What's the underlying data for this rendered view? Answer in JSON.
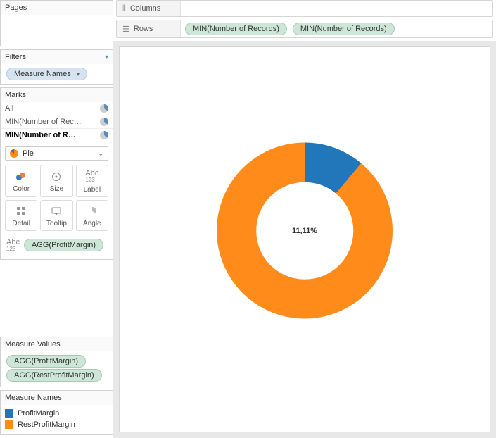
{
  "sidebar": {
    "pages": {
      "title": "Pages"
    },
    "filters": {
      "title": "Filters",
      "pill": "Measure Names"
    },
    "marks": {
      "title": "Marks",
      "rows": [
        "All",
        "MIN(Number of Rec…",
        "MIN(Number of R…"
      ],
      "mark_type": "Pie",
      "buttons": {
        "color": "Color",
        "size": "Size",
        "label": "Label",
        "detail": "Detail",
        "tooltip": "Tooltip",
        "angle": "Angle"
      },
      "drop_pill": "AGG(ProfitMargin)"
    },
    "measure_values": {
      "title": "Measure Values",
      "pills": [
        "AGG(ProfitMargin)",
        "AGG(RestProfitMargin)"
      ]
    },
    "measure_names": {
      "title": "Measure Names",
      "items": [
        "ProfitMargin",
        "RestProfitMargin"
      ]
    }
  },
  "shelves": {
    "columns": {
      "label": "Columns",
      "pills": []
    },
    "rows": {
      "label": "Rows",
      "pills": [
        "MIN(Number of Records)",
        "MIN(Number of Records)"
      ]
    }
  },
  "chart_data": {
    "type": "pie",
    "center_label": "11,11%",
    "series": [
      {
        "name": "ProfitMargin",
        "value": 11.11,
        "color": "#2277bb"
      },
      {
        "name": "RestProfitMargin",
        "value": 88.89,
        "color": "#ff8c1a"
      }
    ],
    "donut": true,
    "start_angle_deg": 0
  }
}
